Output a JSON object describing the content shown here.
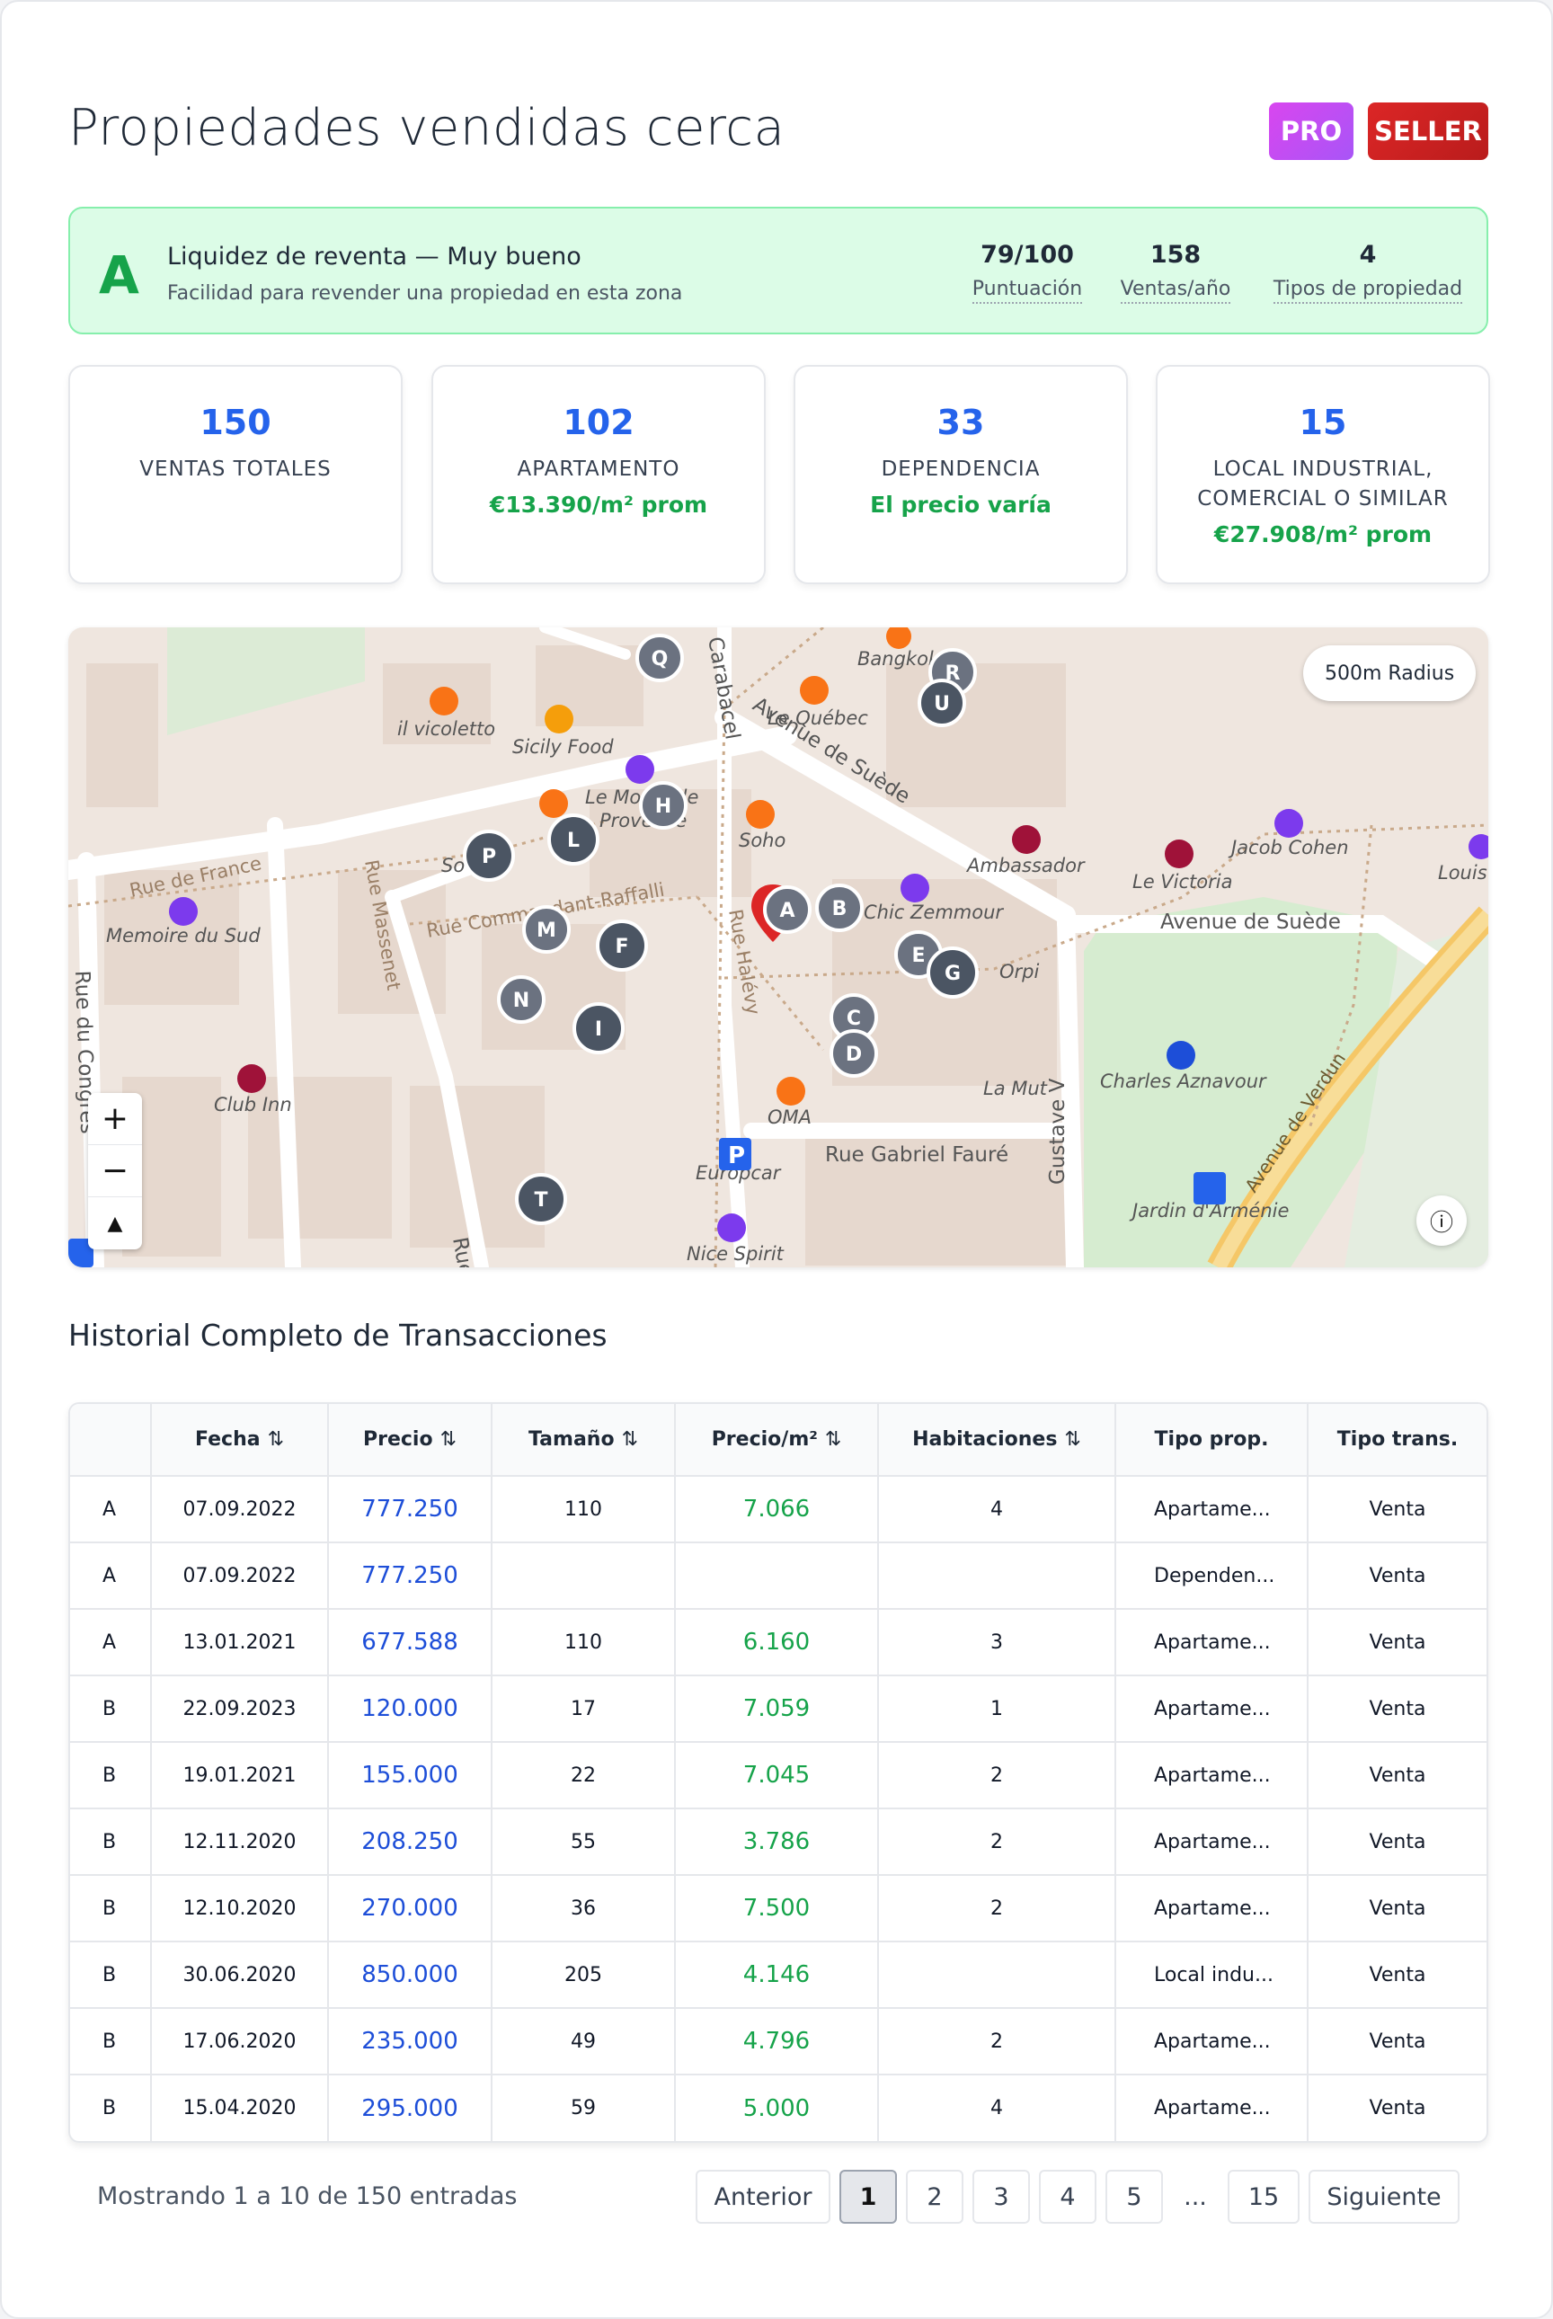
{
  "header": {
    "title": "Propiedades vendidas cerca",
    "badge_pro": "PRO",
    "badge_seller": "SELLER"
  },
  "liquidity": {
    "grade": "A",
    "title": "Liquidez de reventa — Muy bueno",
    "subtitle": "Facilidad para revender una propiedad en esta zona",
    "stats": [
      {
        "value": "79/100",
        "label": "Puntuación"
      },
      {
        "value": "158",
        "label": "Ventas/año"
      },
      {
        "value": "4",
        "label": "Tipos de propiedad"
      }
    ]
  },
  "stat_cards": [
    {
      "number": "150",
      "label": "VENTAS TOTALES",
      "sub": ""
    },
    {
      "number": "102",
      "label": "APARTAMENTO",
      "sub": "€13.390/m² prom"
    },
    {
      "number": "33",
      "label": "DEPENDENCIA",
      "sub": "El precio varía"
    },
    {
      "number": "15",
      "label": "LOCAL INDUSTRIAL, COMERCIAL O SIMILAR",
      "sub": "€27.908/m² prom"
    }
  ],
  "map": {
    "radius_label": "500m Radius",
    "zoom_in": "+",
    "zoom_out": "−",
    "compass": "▲",
    "info": "ⓘ",
    "streets": [
      "Rue de France",
      "Rue Massenet",
      "Rue Commandant-Raffalli",
      "Rue Halévy",
      "Avenue de Suède",
      "Avenue de Suède",
      "Rue Gabriel Fauré",
      "Avenue de Verdun",
      "Rue du Congrès",
      "Carabacel",
      "Rue",
      "Gustave V"
    ],
    "places": [
      "il vicoletto",
      "Sicily Food",
      "Le Québec",
      "Bangkok",
      "Le Mondiale",
      "Provence",
      "Soho",
      "Ambassador",
      "Le Victoria",
      "Jacob Cohen",
      "Louis V",
      "Memoire du Sud",
      "Chic Zemmour",
      "Orpi",
      "Club Inn",
      "OMA",
      "La Mut",
      "Charles Aznavour",
      "Europcar",
      "Nice Spirit",
      "Jardin d'Arménie",
      "So"
    ],
    "markers": [
      "A",
      "B",
      "C",
      "D",
      "E",
      "F",
      "G",
      "H",
      "I",
      "L",
      "M",
      "N",
      "P",
      "Q",
      "R",
      "T",
      "U"
    ]
  },
  "table": {
    "section_title": "Historial Completo de Transacciones",
    "headers": {
      "label": "",
      "fecha": "Fecha",
      "precio": "Precio",
      "tamano": "Tamaño",
      "ppm": "Precio/m²",
      "habitaciones": "Habitaciones",
      "tipo_prop": "Tipo prop.",
      "tipo_trans": "Tipo trans.",
      "sort_glyph": "⇅"
    },
    "rows": [
      {
        "label": "A",
        "fecha": "07.09.2022",
        "precio": "777.250",
        "tamano": "110",
        "ppm": "7.066",
        "hab": "4",
        "tipo": "Apartame...",
        "trans": "Venta"
      },
      {
        "label": "A",
        "fecha": "07.09.2022",
        "precio": "777.250",
        "tamano": "",
        "ppm": "",
        "hab": "",
        "tipo": "Dependen...",
        "trans": "Venta"
      },
      {
        "label": "A",
        "fecha": "13.01.2021",
        "precio": "677.588",
        "tamano": "110",
        "ppm": "6.160",
        "hab": "3",
        "tipo": "Apartame...",
        "trans": "Venta"
      },
      {
        "label": "B",
        "fecha": "22.09.2023",
        "precio": "120.000",
        "tamano": "17",
        "ppm": "7.059",
        "hab": "1",
        "tipo": "Apartame...",
        "trans": "Venta"
      },
      {
        "label": "B",
        "fecha": "19.01.2021",
        "precio": "155.000",
        "tamano": "22",
        "ppm": "7.045",
        "hab": "2",
        "tipo": "Apartame...",
        "trans": "Venta"
      },
      {
        "label": "B",
        "fecha": "12.11.2020",
        "precio": "208.250",
        "tamano": "55",
        "ppm": "3.786",
        "hab": "2",
        "tipo": "Apartame...",
        "trans": "Venta"
      },
      {
        "label": "B",
        "fecha": "12.10.2020",
        "precio": "270.000",
        "tamano": "36",
        "ppm": "7.500",
        "hab": "2",
        "tipo": "Apartame...",
        "trans": "Venta"
      },
      {
        "label": "B",
        "fecha": "30.06.2020",
        "precio": "850.000",
        "tamano": "205",
        "ppm": "4.146",
        "hab": "",
        "tipo": "Local indu...",
        "trans": "Venta"
      },
      {
        "label": "B",
        "fecha": "17.06.2020",
        "precio": "235.000",
        "tamano": "49",
        "ppm": "4.796",
        "hab": "2",
        "tipo": "Apartame...",
        "trans": "Venta"
      },
      {
        "label": "B",
        "fecha": "15.04.2020",
        "precio": "295.000",
        "tamano": "59",
        "ppm": "5.000",
        "hab": "4",
        "tipo": "Apartame...",
        "trans": "Venta"
      }
    ]
  },
  "pagination": {
    "showing": "Mostrando 1 a 10 de 150 entradas",
    "prev": "Anterior",
    "pages": [
      "1",
      "2",
      "3",
      "4",
      "5"
    ],
    "ellipsis": "...",
    "last": "15",
    "next": "Siguiente",
    "active": "1"
  },
  "colors": {
    "accent_blue": "#2563eb",
    "green": "#16a34a",
    "pro_gradient": "#d946ef",
    "seller_red": "#dc2626"
  }
}
